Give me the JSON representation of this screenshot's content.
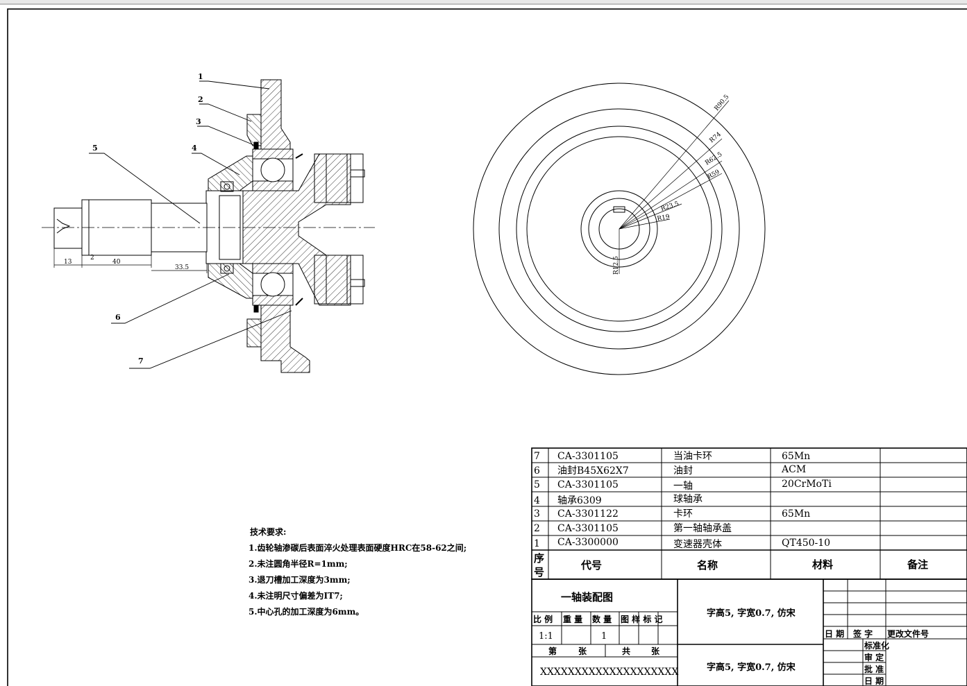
{
  "part_callouts": [
    "1",
    "2",
    "3",
    "4",
    "5",
    "6",
    "7"
  ],
  "dimensions_shaft": [
    "13",
    "2",
    "40",
    "33.5"
  ],
  "dimensions_end_view": [
    "R90.5",
    "R74",
    "R62.5",
    "R59",
    "R23.5",
    "R19",
    "R12.5"
  ],
  "tech_requirements": {
    "heading": "技术要求:",
    "items": [
      "1.齿轮轴渗碳后表面淬火处理表面硬度HRC在58-62之间;",
      "2.未注圆角半径R=1mm;",
      "3.退刀槽加工深度为3mm;",
      "4.未注明尺寸偏差为IT7;",
      "5.中心孔的加工深度为6mm。"
    ]
  },
  "bom": {
    "rows": [
      {
        "no": "7",
        "code": "CA-3301105",
        "name": "当油卡环",
        "material": "65Mn",
        "note": ""
      },
      {
        "no": "6",
        "code": "油封B45X62X7",
        "name": "油封",
        "material": "ACM",
        "note": ""
      },
      {
        "no": "5",
        "code": "CA-3301105",
        "name": "一轴",
        "material": "20CrMoTi",
        "note": ""
      },
      {
        "no": "4",
        "code": "轴承6309",
        "name": "球轴承",
        "material": "",
        "note": ""
      },
      {
        "no": "3",
        "code": "CA-3301122",
        "name": "卡环",
        "material": "65Mn",
        "note": ""
      },
      {
        "no": "2",
        "code": "CA-3301105",
        "name": "第一轴轴承盖",
        "material": "",
        "note": ""
      },
      {
        "no": "1",
        "code": "CA-3300000",
        "name": "变速器壳体",
        "material": "QT450-10",
        "note": ""
      }
    ],
    "header": {
      "no_top": "序",
      "no_bottom": "号",
      "code": "代号",
      "name": "名称",
      "material": "材料",
      "note": "备注"
    }
  },
  "title_block": {
    "drawing_name": "一轴装配图",
    "font_note_1": "字高5, 字宽0.7, 仿宋",
    "font_note_2": "字高5, 字宽0.7, 仿宋",
    "label_scale": "比 例",
    "label_weight": "重 量",
    "label_qty": "数 量",
    "label_sample": "图 样 标 记",
    "scale": "1:1",
    "qty": "1",
    "sheet_no": "第",
    "sheet_unit": "张",
    "sheet_total": "共",
    "sheet_total_unit": "张",
    "drawing_code": "XXXXXXXXXXXXXXXXXXXX",
    "rev_date": "日 期",
    "rev_sign": "签 字",
    "rev_doc": "更改文件号",
    "std": "标准化",
    "review": "审 定",
    "approve": "批 准",
    "date": "日 期"
  }
}
